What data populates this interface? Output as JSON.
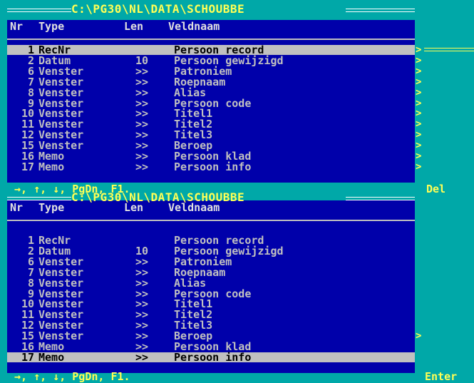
{
  "top": {
    "title": "C:\\PG30\\NL\\DATA\\SCHOUBBE",
    "headers": {
      "nr": "Nr",
      "type": "Type",
      "len": "Len",
      "name": "Veldnaam"
    },
    "rows": [
      {
        "nr": "1",
        "type": "RecNr",
        "len": "",
        "name": "Persoon record",
        "arrow": ">"
      },
      {
        "nr": "2",
        "type": "Datum",
        "len": "10",
        "name": "Persoon gewijzigd",
        "arrow": ">"
      },
      {
        "nr": "6",
        "type": "Venster",
        "len": ">>",
        "name": "Patroniem",
        "arrow": ">"
      },
      {
        "nr": "7",
        "type": "Venster",
        "len": ">>",
        "name": "Roepnaam",
        "arrow": ">"
      },
      {
        "nr": "8",
        "type": "Venster",
        "len": ">>",
        "name": "Alias",
        "arrow": ">"
      },
      {
        "nr": "9",
        "type": "Venster",
        "len": ">>",
        "name": "Persoon code",
        "arrow": ">"
      },
      {
        "nr": "10",
        "type": "Venster",
        "len": ">>",
        "name": "Titel1",
        "arrow": ">"
      },
      {
        "nr": "11",
        "type": "Venster",
        "len": ">>",
        "name": "Titel2",
        "arrow": ">"
      },
      {
        "nr": "12",
        "type": "Venster",
        "len": ">>",
        "name": "Titel3",
        "arrow": ">"
      },
      {
        "nr": "15",
        "type": "Venster",
        "len": ">>",
        "name": "Beroep",
        "arrow": ">"
      },
      {
        "nr": "16",
        "type": "Memo",
        "len": ">>",
        "name": "Persoon klad",
        "arrow": ">"
      },
      {
        "nr": "17",
        "type": "Memo",
        "len": ">>",
        "name": "Persoon info",
        "arrow": ">"
      }
    ],
    "selected_index": 0,
    "footer": "→, ↑, ↓, PgDn, F1.",
    "key_label": "Del"
  },
  "bottom": {
    "title": "C:\\PG30\\NL\\DATA\\SCHOUBBE",
    "headers": {
      "nr": "Nr",
      "type": "Type",
      "len": "Len",
      "name": "Veldnaam"
    },
    "rows": [
      {
        "nr": "1",
        "type": "RecNr",
        "len": "",
        "name": "Persoon record",
        "arrow": ""
      },
      {
        "nr": "2",
        "type": "Datum",
        "len": "10",
        "name": "Persoon gewijzigd",
        "arrow": ""
      },
      {
        "nr": "6",
        "type": "Venster",
        "len": ">>",
        "name": "Patroniem",
        "arrow": ""
      },
      {
        "nr": "7",
        "type": "Venster",
        "len": ">>",
        "name": "Roepnaam",
        "arrow": ""
      },
      {
        "nr": "8",
        "type": "Venster",
        "len": ">>",
        "name": "Alias",
        "arrow": ""
      },
      {
        "nr": "9",
        "type": "Venster",
        "len": ">>",
        "name": "Persoon code",
        "arrow": ""
      },
      {
        "nr": "10",
        "type": "Venster",
        "len": ">>",
        "name": "Titel1",
        "arrow": ""
      },
      {
        "nr": "11",
        "type": "Venster",
        "len": ">>",
        "name": "Titel2",
        "arrow": ""
      },
      {
        "nr": "12",
        "type": "Venster",
        "len": ">>",
        "name": "Titel3",
        "arrow": ""
      },
      {
        "nr": "15",
        "type": "Venster",
        "len": ">>",
        "name": "Beroep",
        "arrow": ">"
      },
      {
        "nr": "16",
        "type": "Memo",
        "len": ">>",
        "name": "Persoon klad",
        "arrow": ""
      },
      {
        "nr": "17",
        "type": "Memo",
        "len": ">>",
        "name": "Persoon info",
        "arrow": ""
      }
    ],
    "selected_index": 11,
    "footer": "→, ↑, ↓, PgDn, F1.",
    "key_label": "Enter"
  }
}
